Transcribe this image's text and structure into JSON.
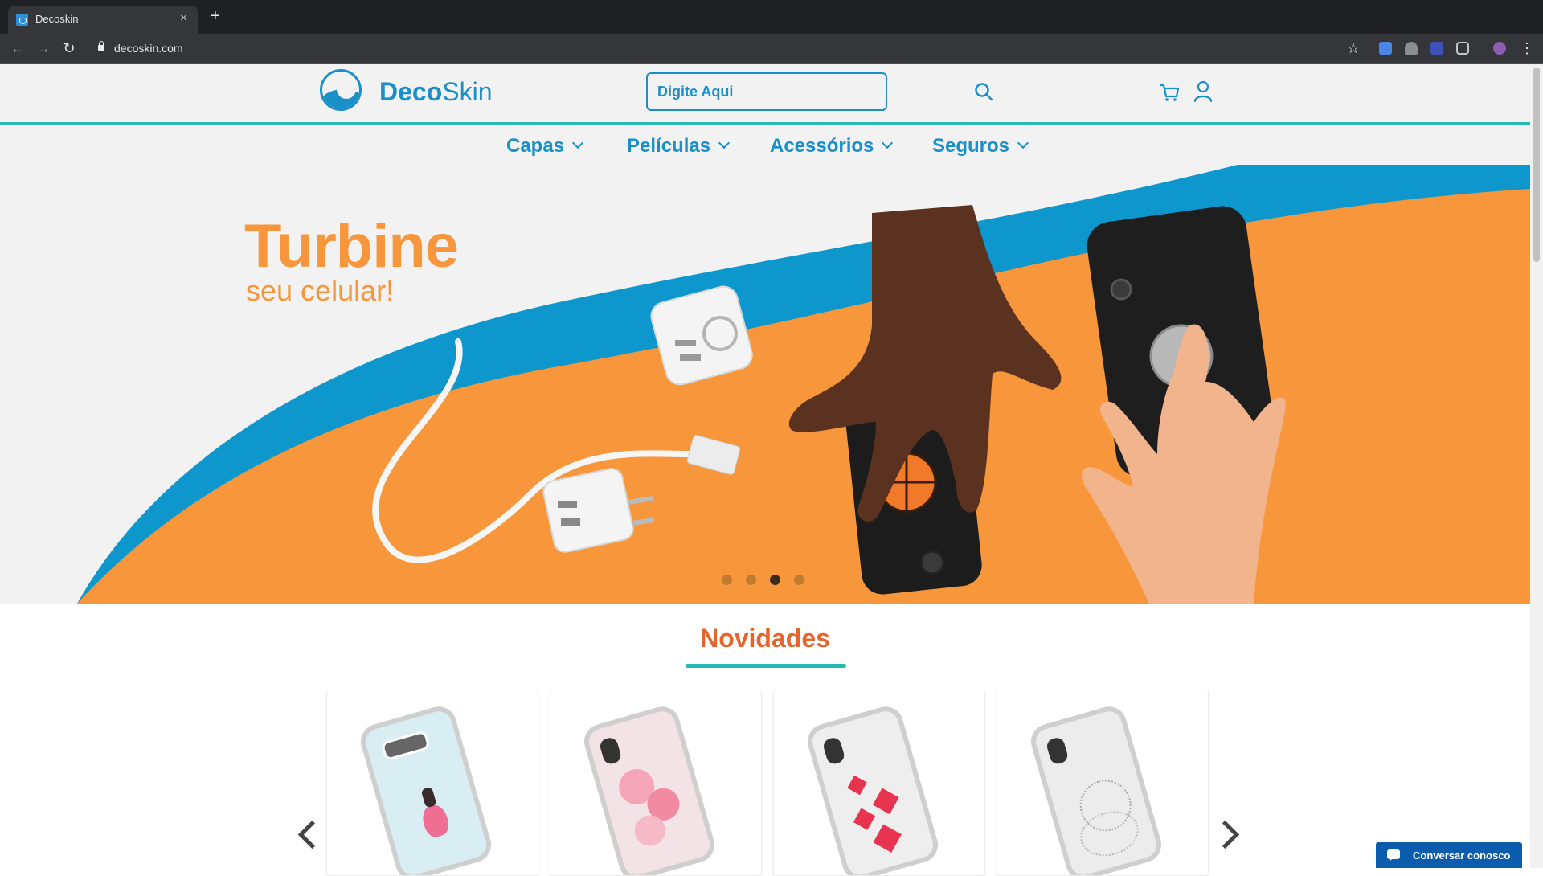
{
  "browser": {
    "tab_title": "Decoskin",
    "tab_close": "×",
    "new_tab": "+",
    "url": "decoskin.com",
    "back": "←",
    "forward": "→",
    "reload": "↻",
    "star": "☆",
    "menu": "⋮"
  },
  "header": {
    "logo_bold": "Deco",
    "logo_light": "Skin",
    "search_placeholder": "Digite Aqui"
  },
  "nav": {
    "items": [
      {
        "label": "Capas"
      },
      {
        "label": "Películas"
      },
      {
        "label": "Acessórios"
      },
      {
        "label": "Seguros"
      }
    ]
  },
  "hero": {
    "title": "Turbine",
    "subtitle": "seu celular!",
    "slides": 4,
    "active_slide": 3
  },
  "section": {
    "title": "Novidades"
  },
  "products": [
    {
      "icon": "phone-case-ballerina"
    },
    {
      "icon": "phone-case-pink-flowers"
    },
    {
      "icon": "phone-case-hearts"
    },
    {
      "icon": "phone-case-lace"
    }
  ],
  "chat": {
    "label": "Conversar conosco"
  },
  "colors": {
    "brand_blue": "#1a8fc8",
    "teal": "#27b8b3",
    "orange": "#f7963a",
    "section_title": "#e6652e"
  }
}
